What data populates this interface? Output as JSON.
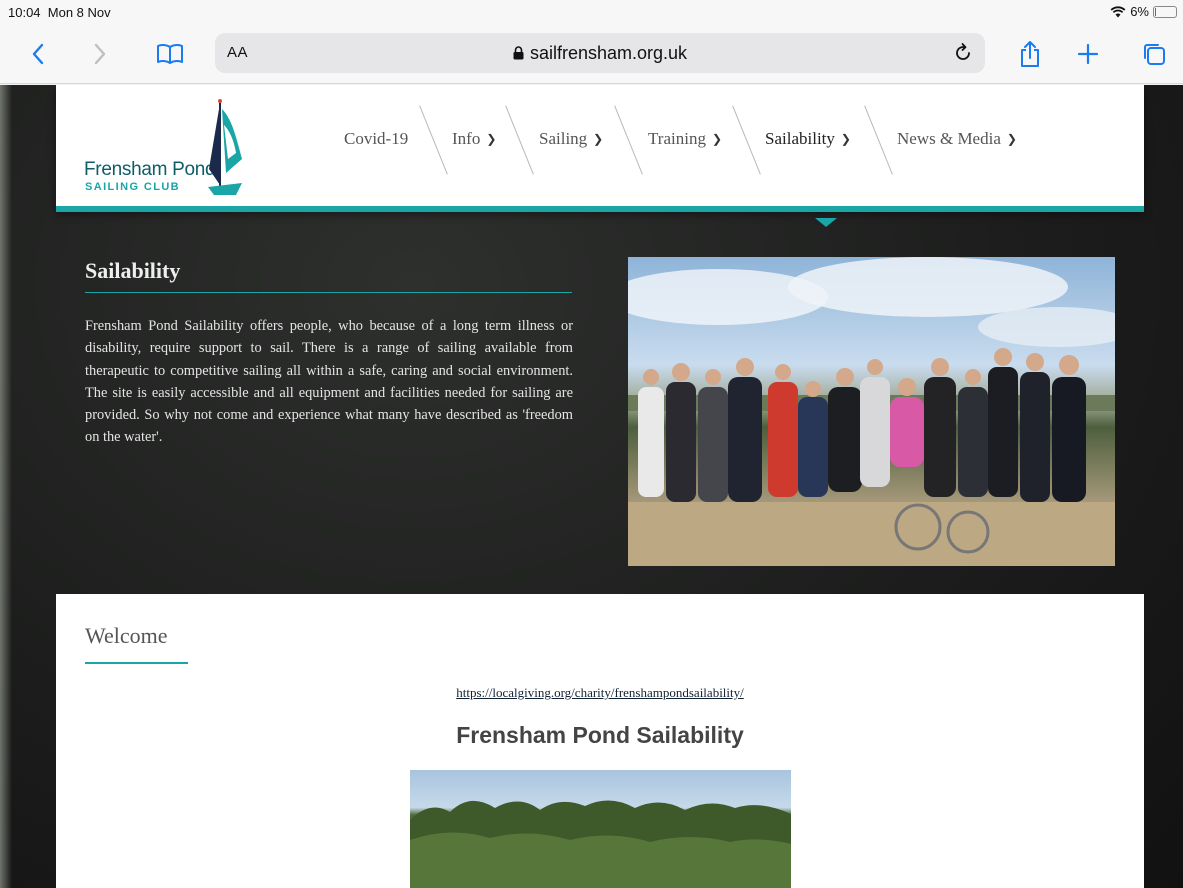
{
  "status_bar": {
    "time": "10:04",
    "date": "Mon 8 Nov",
    "battery": "6%",
    "battery_level": 0.06
  },
  "browser": {
    "text_size_label": "AA",
    "url": "sailfrensham.org.uk"
  },
  "site": {
    "logo_name": "Frensham Pond",
    "logo_sub": "SAILING CLUB",
    "nav": [
      {
        "label": "Covid-19",
        "has_dropdown": false
      },
      {
        "label": "Info",
        "has_dropdown": true
      },
      {
        "label": "Sailing",
        "has_dropdown": true
      },
      {
        "label": "Training",
        "has_dropdown": true
      },
      {
        "label": "Sailability",
        "has_dropdown": true,
        "active": true
      },
      {
        "label": "News & Media",
        "has_dropdown": true
      }
    ],
    "accent_color": "#1aa5a7"
  },
  "hero": {
    "title": "Sailability",
    "text": "Frensham Pond Sailability offers people, who because of a long term illness or disability, require support to sail. There is a range of sailing available from therapeutic to competitive sailing all within a safe, caring and social environment. The site is easily accessible and all equipment and facilities needed for sailing are provided. So why not come and experience what many have described as 'freedom on the water'."
  },
  "content": {
    "heading": "Welcome",
    "link": "https://localgiving.org/charity/frenshampondsailability/",
    "subheading": "Frensham Pond Sailability"
  }
}
